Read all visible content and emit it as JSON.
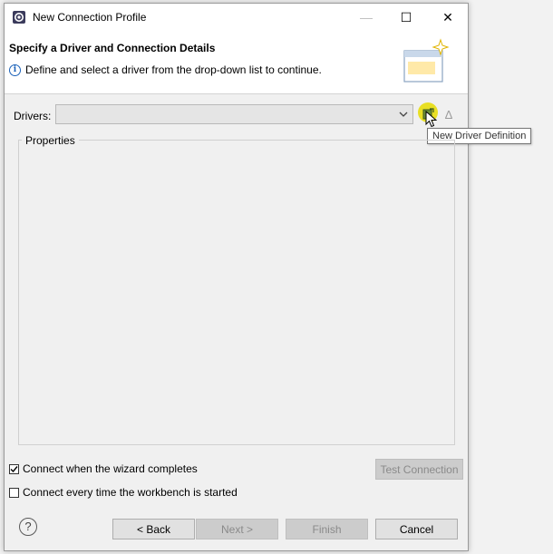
{
  "window": {
    "title": "New Connection Profile",
    "controls": {
      "minimize_glyph": "—",
      "maximize_glyph": "☐",
      "close_glyph": "✕"
    },
    "app_icon": "eclipse-gear-icon"
  },
  "banner": {
    "title": "Specify a Driver and Connection Details",
    "description": "Define and select a driver from the drop-down list to continue.",
    "info_icon": "info-icon",
    "image": "wizard-banner-image"
  },
  "drivers": {
    "label": "Drivers:",
    "selected_value": "",
    "new_driver_icon": "new-driver-definition-icon",
    "edit_driver_icon": "edit-driver-definition-icon",
    "edit_glyph": "Δ",
    "tooltip": "New Driver Definition"
  },
  "properties": {
    "label": "Properties"
  },
  "options": {
    "connect_on_complete": {
      "label": "Connect when the wizard completes",
      "checked": true
    },
    "connect_on_start": {
      "label": "Connect every time the workbench is started",
      "checked": false
    }
  },
  "buttons": {
    "test_connection": "Test Connection",
    "back": "< Back",
    "next": "Next >",
    "finish": "Finish",
    "cancel": "Cancel",
    "help_glyph": "?"
  },
  "colors": {
    "highlight": "#e6dc00",
    "disabled_text": "#8a8a8a",
    "info_blue": "#1c62b9"
  }
}
